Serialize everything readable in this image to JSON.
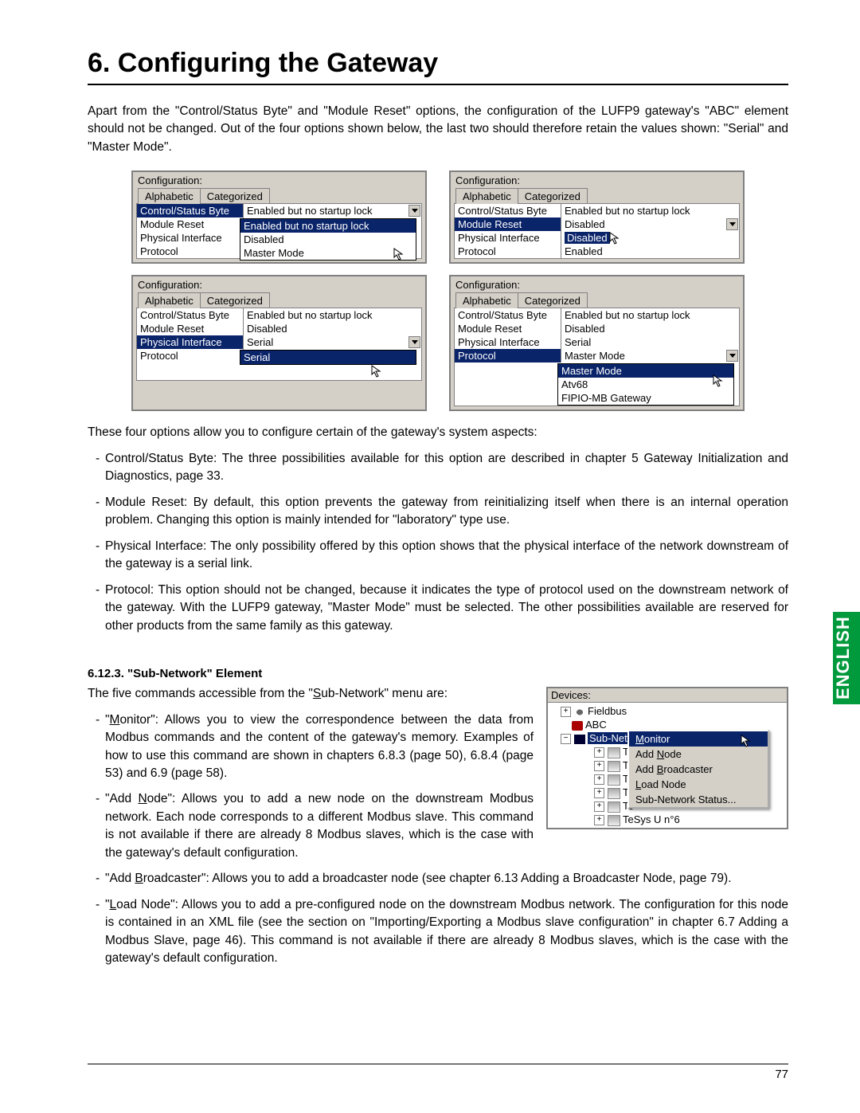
{
  "heading": "6. Configuring the Gateway",
  "intro": "Apart from the \"Control/Status Byte\" and \"Module Reset\" options, the configuration of the LUFP9 gateway's \"ABC\" element should not be changed. Out of the four options shown below, the last two should therefore retain the values shown: \"Serial\" and \"Master Mode\".",
  "config_label": "Configuration:",
  "tabs": {
    "alpha": "Alphabetic",
    "cat": "Categorized"
  },
  "rows": {
    "csb": "Control/Status Byte",
    "mr": "Module Reset",
    "pi": "Physical Interface",
    "pr": "Protocol"
  },
  "shot1": {
    "csb": "Enabled but no startup lock",
    "mr": "Enabled",
    "pi": "Enabled but no startup lock",
    "pr": "",
    "dd": [
      "Enabled but no startup lock",
      "Disabled",
      "Master Mode"
    ],
    "sel_row": "csb",
    "dd_sel": 0
  },
  "shot2": {
    "csb": "Enabled but no startup lock",
    "mr": "Disabled",
    "pi": "Disabled",
    "pr": "Enabled",
    "sel_row": "mr",
    "dd_sel_txt": "Disabled"
  },
  "shot3": {
    "csb": "Enabled but no startup lock",
    "mr": "Disabled",
    "pi": "Serial",
    "pr": "",
    "sel_row": "pi",
    "dd": [
      "Serial"
    ],
    "dd_sel": 0
  },
  "shot4": {
    "csb": "Enabled but no startup lock",
    "mr": "Disabled",
    "pi": "Serial",
    "pr": "Master Mode",
    "sel_row": "pr",
    "dd": [
      "Master Mode",
      "Atv68",
      "FIPIO-MB Gateway"
    ],
    "dd_sel": 0
  },
  "after_shots": "These four options allow you to configure certain of the gateway's system aspects:",
  "bullets1": [
    "Control/Status Byte: The three possibilities available for this option are described in chapter 5 Gateway Initialization and Diagnostics, page 33.",
    "Module Reset: By default, this option prevents the gateway from reinitializing itself when there is an internal operation problem. Changing this option is mainly intended for \"laboratory\" type use.",
    "Physical Interface: The only possibility offered by this option shows that the physical interface of the network downstream of the gateway is a serial link.",
    "Protocol: This option should not be changed, because it indicates the type of protocol used on the downstream network of the gateway. With the LUFP9 gateway, \"Master Mode\" must be selected. The other possibilities available are reserved for other products from the same family as this gateway."
  ],
  "subhead": "6.12.3. \"Sub-Network\" Element",
  "subintro_pre": "The five commands accessible from the \"",
  "subintro_u": "S",
  "subintro_post": "ub-Network\" menu are:",
  "bullets2": [
    {
      "pre": "\"",
      "u": "M",
      "post": "onitor\": Allows you to view the correspondence between the data from Modbus commands and the content of the gateway's memory. Examples of how to use this command are shown in chapters 6.8.3 (page 50), 6.8.4 (page 53) and 6.9 (page 58)."
    },
    {
      "pre": "\"Add ",
      "u": "N",
      "post": "ode\": Allows you to add a new node on the downstream Modbus network. Each node corresponds to a different Modbus slave. This command is not available if there are already 8 Modbus slaves, which is the case with the gateway's default configuration."
    },
    {
      "pre": "\"Add ",
      "u": "B",
      "post": "roadcaster\": Allows you to add a broadcaster node (see chapter 6.13 Adding a Broadcaster Node, page 79)."
    },
    {
      "pre": "\"",
      "u": "L",
      "post": "oad Node\": Allows you to add a pre-configured node on the downstream Modbus network. The configuration for this node is contained in an XML file (see the section on \"Importing/Exporting a Modbus slave configuration\" in chapter 6.7 Adding a Modbus Slave, page 46). This command is not available if there are already 8 Modbus slaves, which is the case with the gateway's default configuration."
    }
  ],
  "tree": {
    "header": "Devices:",
    "fieldbus": "Fieldbus",
    "abc": "ABC",
    "subnet": "Sub-Network",
    "te": "Te",
    "last": "TeSys U n°6"
  },
  "ctx": {
    "monitor": "Monitor",
    "monitor_u": "M",
    "addnode": "Add Node",
    "addnode_u": "N",
    "addbc": "Add Broadcaster",
    "addbc_u": "B",
    "loadnode": "Load Node",
    "loadnode_u": "L",
    "status": "Sub-Network Status..."
  },
  "side_tab": "ENGLISH",
  "page_no": "77"
}
